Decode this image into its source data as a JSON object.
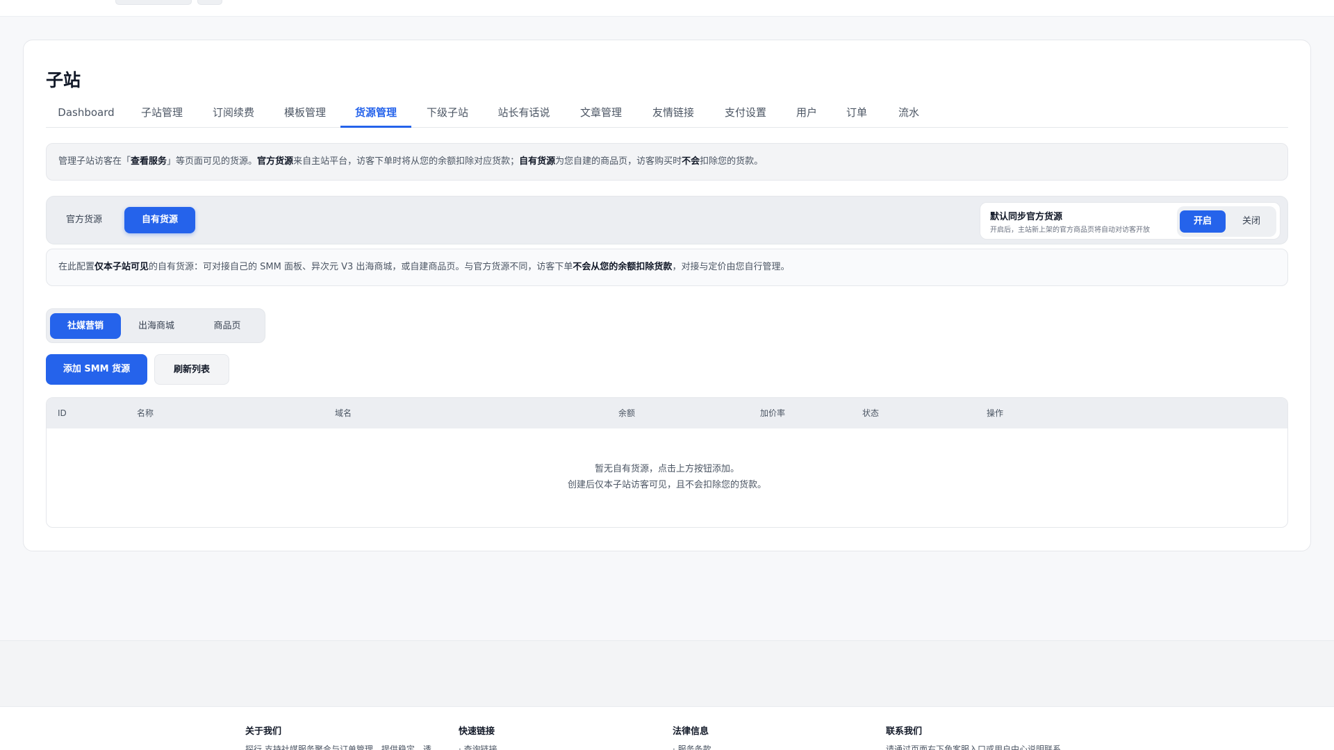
{
  "page": {
    "title": "子站",
    "tabs": [
      {
        "label": "Dashboard"
      },
      {
        "label": "子站管理"
      },
      {
        "label": "订阅续费"
      },
      {
        "label": "模板管理"
      },
      {
        "label": "货源管理",
        "active": true
      },
      {
        "label": "下级子站"
      },
      {
        "label": "站长有话说"
      },
      {
        "label": "文章管理"
      },
      {
        "label": "友情链接"
      },
      {
        "label": "支付设置"
      },
      {
        "label": "用户"
      },
      {
        "label": "订单"
      },
      {
        "label": "流水"
      }
    ]
  },
  "notice_top": {
    "t1": "管理子站访客在「",
    "b1": "查看服务",
    "t2": "」等页面可见的货源。",
    "b2": "官方货源",
    "t3": "来自主站平台，访客下单时将从您的余额扣除对应货款；",
    "b3": "自有货源",
    "t4": "为您自建的商品页，访客购买时",
    "b4": "不会",
    "t5": "扣除您的货款。"
  },
  "source_switch": {
    "official": "官方货源",
    "own": "自有货源",
    "selected": "own"
  },
  "sync": {
    "title": "默认同步官方货源",
    "desc": "开启后，主站新上架的官方商品页将自动对访客开放",
    "on_label": "开启",
    "off_label": "关闭",
    "state": "on"
  },
  "notice_own": {
    "t1": "在此配置",
    "b1": "仅本子站可见",
    "t2": "的自有货源：可对接自己的 SMM 面板、异次元 V3 出海商城，或自建商品页。与官方货源不同，访客下单",
    "b2": "不会从您的余额扣除货款",
    "t3": "，对接与定价由您自行管理。"
  },
  "categories": [
    {
      "label": "社媒营销",
      "active": true
    },
    {
      "label": "出海商城"
    },
    {
      "label": "商品页"
    }
  ],
  "actions": {
    "add": "添加 SMM 货源",
    "refresh": "刷新列表"
  },
  "table": {
    "columns": [
      "ID",
      "名称",
      "域名",
      "余额",
      "加价率",
      "状态",
      "操作"
    ],
    "rows": [],
    "empty_line1": "暂无自有货源，点击上方按钮添加。",
    "empty_line2": "创建后仅本子站访客可见，且不会扣除您的货款。"
  },
  "footer": {
    "about": {
      "title": "关于我们",
      "text": "探行 支持社媒服务聚合与订单管理，提供稳定、透"
    },
    "links": {
      "title": "快速链接",
      "text": "· 查询链接"
    },
    "legal": {
      "title": "法律信息",
      "text": "· 服务条款"
    },
    "contact": {
      "title": "联系我们",
      "text": "请通过页面右下角客服入口或用户中心说明联系"
    }
  },
  "colors": {
    "accent": "#2563eb",
    "background": "#f7f8fa",
    "card": "#ffffff"
  }
}
